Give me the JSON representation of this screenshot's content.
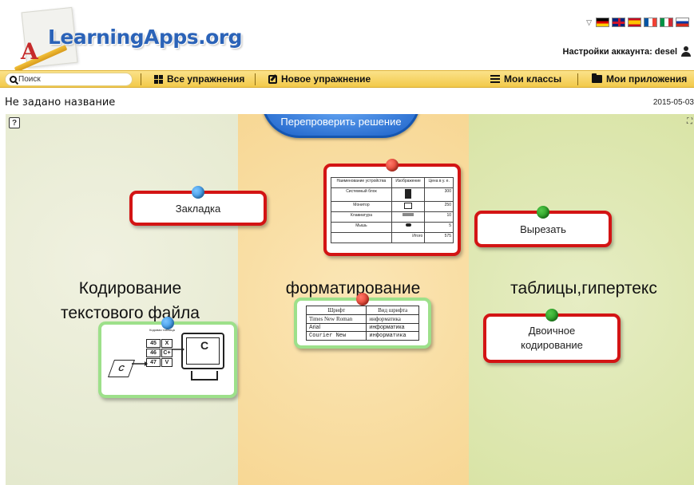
{
  "header": {
    "logo_text": "LearningApps.org",
    "logo_letter": "A",
    "account_label": "Настройки аккаунта: desel",
    "languages": [
      "Deutsch",
      "English",
      "Español",
      "Français",
      "Italiano",
      "Русский"
    ]
  },
  "toolbar": {
    "search_placeholder": "Поиск",
    "all_exercises": "Все упражнения",
    "new_exercise": "Новое упражнение",
    "my_classes": "Мои классы",
    "my_apps": "Мои приложения"
  },
  "app": {
    "title": "Не задано название",
    "date": "2015-05-03"
  },
  "board": {
    "check_button": "Перепроверить решение",
    "help_icon": "?",
    "fullscreen_icon": "⛶",
    "categories": [
      {
        "name": "category-1",
        "lines": [
          "Кодирование",
          "текстового файла"
        ],
        "color": "#e6ebd0"
      },
      {
        "name": "category-2",
        "lines": [
          "форматирование"
        ],
        "color": "#f8dba0"
      },
      {
        "name": "category-3",
        "lines": [
          "таблицы,гипертекс"
        ],
        "color": "#dde7b0"
      }
    ],
    "cards": {
      "bookmark": "Закладка",
      "cut": "Вырезать",
      "binary_line1": "Двоичное",
      "binary_line2": "кодирование"
    },
    "spec_table": {
      "headers": [
        "Наименование устройства",
        "Изображение",
        "Цена в у. е."
      ],
      "rows": [
        {
          "device": "Системный блок",
          "price": "300"
        },
        {
          "device": "Монитор",
          "price": "250"
        },
        {
          "device": "Клавиатура",
          "price": "10"
        },
        {
          "device": "Мышь",
          "price": "5"
        }
      ],
      "total_label": "Итого",
      "total": "575"
    },
    "font_table": {
      "headers": [
        "Шрифт",
        "Вид шрифта"
      ],
      "rows": [
        [
          "Times New Roman",
          "информатика"
        ],
        [
          "Arial",
          "информатика"
        ],
        [
          "Courier New",
          "информатика"
        ]
      ]
    },
    "encoding_image": {
      "table_title": "Кодовая таблица",
      "codes": [
        "45",
        "46",
        "47"
      ],
      "chars": [
        "X",
        "C+",
        "V"
      ],
      "key_letter": "C",
      "screen_letter": "C"
    }
  }
}
